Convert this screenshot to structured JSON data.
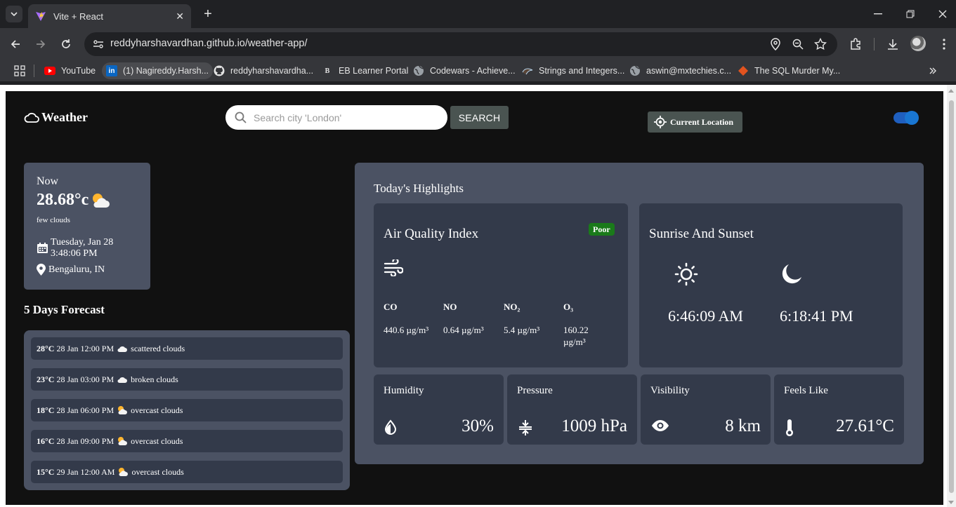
{
  "browser": {
    "tab_title": "Vite + React",
    "url": "reddyharshavardhan.github.io/weather-app/",
    "bookmarks": [
      {
        "label": "YouTube",
        "icon": "youtube-icon"
      },
      {
        "label": "(1) Nagireddy.Harsh...",
        "icon": "linkedin-icon"
      },
      {
        "label": "reddyharshavardha...",
        "icon": "github-icon"
      },
      {
        "label": "EB Learner Portal",
        "icon": "eb-icon"
      },
      {
        "label": "Codewars - Achieve...",
        "icon": "globe-icon"
      },
      {
        "label": "Strings and Integers...",
        "icon": "codechef-icon"
      },
      {
        "label": "aswin@mxtechies.c...",
        "icon": "globe-icon"
      },
      {
        "label": "The SQL Murder My...",
        "icon": "sql-icon"
      }
    ]
  },
  "header": {
    "brand": "Weather",
    "search_placeholder": "Search city 'London'",
    "search_button": "SEARCH",
    "location_button": "Current Location"
  },
  "now": {
    "label": "Now",
    "temp": "28.68°c",
    "desc": "few clouds",
    "date": "Tuesday, Jan 28",
    "time": "3:48:06 PM",
    "location": "Bengaluru, IN"
  },
  "forecast": {
    "title": "5 Days Forecast",
    "items": [
      {
        "temp": "28°C",
        "when": "28 Jan 12:00 PM",
        "desc": "scattered clouds",
        "icon": "cloud"
      },
      {
        "temp": "23°C",
        "when": "28 Jan 03:00 PM",
        "desc": "broken clouds",
        "icon": "cloud"
      },
      {
        "temp": "18°C",
        "when": "28 Jan 06:00 PM",
        "desc": "overcast clouds",
        "icon": "sun-cloud"
      },
      {
        "temp": "16°C",
        "when": "28 Jan 09:00 PM",
        "desc": "overcast clouds",
        "icon": "sun-cloud"
      },
      {
        "temp": "15°C",
        "when": "29 Jan 12:00 AM",
        "desc": "overcast clouds",
        "icon": "sun-cloud"
      }
    ]
  },
  "highlights": {
    "title": "Today's Highlights",
    "aqi": {
      "title": "Air Quality Index",
      "badge": "Poor",
      "badge_color": "#1a7a1a",
      "pollutants": [
        {
          "name": "CO",
          "value": "440.6 µg/m³"
        },
        {
          "name": "NO",
          "value": "0.64 µg/m³"
        },
        {
          "name": "NO₂",
          "value": "5.4 µg/m³"
        },
        {
          "name": "O₃",
          "value": "160.22 µg/m³"
        }
      ]
    },
    "sun": {
      "title": "Sunrise And Sunset",
      "sunrise": "6:46:09 AM",
      "sunset": "6:18:41 PM"
    },
    "humidity": {
      "title": "Humidity",
      "value": "30%"
    },
    "pressure": {
      "title": "Pressure",
      "value": "1009 hPa"
    },
    "visibility": {
      "title": "Visibility",
      "value": "8 km"
    },
    "feels_like": {
      "title": "Feels Like",
      "value": "27.61°C"
    }
  },
  "colors": {
    "background": "#111111",
    "card": "#4b5263",
    "inner_card": "#333a4a",
    "toggle": "#1976d2"
  }
}
